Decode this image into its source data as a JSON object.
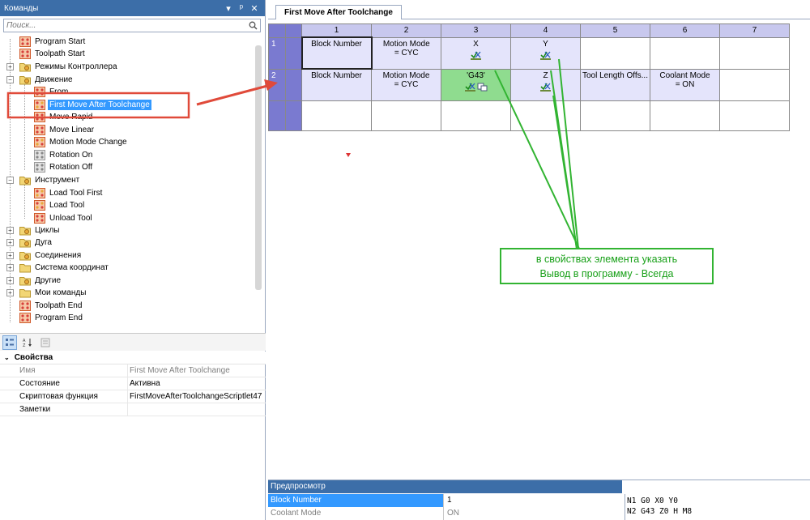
{
  "left_panel": {
    "title": "Команды",
    "controls": [
      "▾",
      "ᵖ",
      "✕"
    ],
    "search_placeholder": "Поиск...",
    "tree": [
      {
        "label": "Program Start",
        "icon": "command-icon"
      },
      {
        "label": "Toolpath Start",
        "icon": "command-icon"
      },
      {
        "label": "Режимы Контроллера",
        "icon": "folder-icon"
      },
      {
        "label": "Движение",
        "icon": "folder-icon"
      },
      {
        "label": "From",
        "icon": "command-icon"
      },
      {
        "label": "First Move After Toolchange",
        "icon": "command-icon"
      },
      {
        "label": "Move Rapid",
        "icon": "command-icon"
      },
      {
        "label": "Move Linear",
        "icon": "command-icon"
      },
      {
        "label": "Motion Mode Change",
        "icon": "command-icon"
      },
      {
        "label": "Rotation On",
        "icon": "command-icon"
      },
      {
        "label": "Rotation Off",
        "icon": "command-icon"
      },
      {
        "label": "Инструмент",
        "icon": "folder-icon"
      },
      {
        "label": "Load Tool First",
        "icon": "command-icon"
      },
      {
        "label": "Load Tool",
        "icon": "command-icon"
      },
      {
        "label": "Unload Tool",
        "icon": "command-icon"
      },
      {
        "label": "Циклы",
        "icon": "folder-icon"
      },
      {
        "label": "Дуга",
        "icon": "folder-icon"
      },
      {
        "label": "Соединения",
        "icon": "folder-icon"
      },
      {
        "label": "Система координат",
        "icon": "folder-icon"
      },
      {
        "label": "Другие",
        "icon": "folder-icon"
      },
      {
        "label": "Мои команды",
        "icon": "folder-icon"
      },
      {
        "label": "Toolpath End",
        "icon": "command-icon"
      },
      {
        "label": "Program End",
        "icon": "command-icon"
      }
    ],
    "properties": {
      "section": "Свойства",
      "rows": [
        {
          "key": "Имя",
          "value": "First Move After Toolchange"
        },
        {
          "key": "Состояние",
          "value": "Активна"
        },
        {
          "key": "Скриптовая функция",
          "value": "FirstMoveAfterToolchangeScriptlet47"
        },
        {
          "key": "Заметки",
          "value": ""
        }
      ]
    }
  },
  "editor": {
    "tab": "First Move After Toolchange",
    "columns": [
      "1",
      "2",
      "3",
      "4",
      "5",
      "6",
      "7"
    ],
    "rows": [
      {
        "num": "1",
        "cells": [
          "Block Number",
          "Motion Mode\n= CYC",
          "X",
          "Y",
          "",
          "",
          ""
        ]
      },
      {
        "num": "2",
        "cells": [
          "Block Number",
          "Motion Mode\n= CYC",
          "'G43'",
          "Z",
          "Tool Length Offs...",
          "Coolant Mode\n= ON",
          ""
        ]
      }
    ]
  },
  "preview": {
    "title": "Предпросмотр",
    "rows": [
      {
        "key": "Block Number",
        "value": "1"
      },
      {
        "key": "Coolant Mode",
        "value": "ON"
      }
    ],
    "gcode": [
      "N1 G0 X0 Y0",
      "N2 G43 Z0 H M8"
    ]
  },
  "annotation": {
    "note_line1": "в свойствах элемента указать",
    "note_line2": "Вывод в программу - Всегда",
    "colors": {
      "highlight": "#e04a3a",
      "note": "#32b432"
    }
  }
}
